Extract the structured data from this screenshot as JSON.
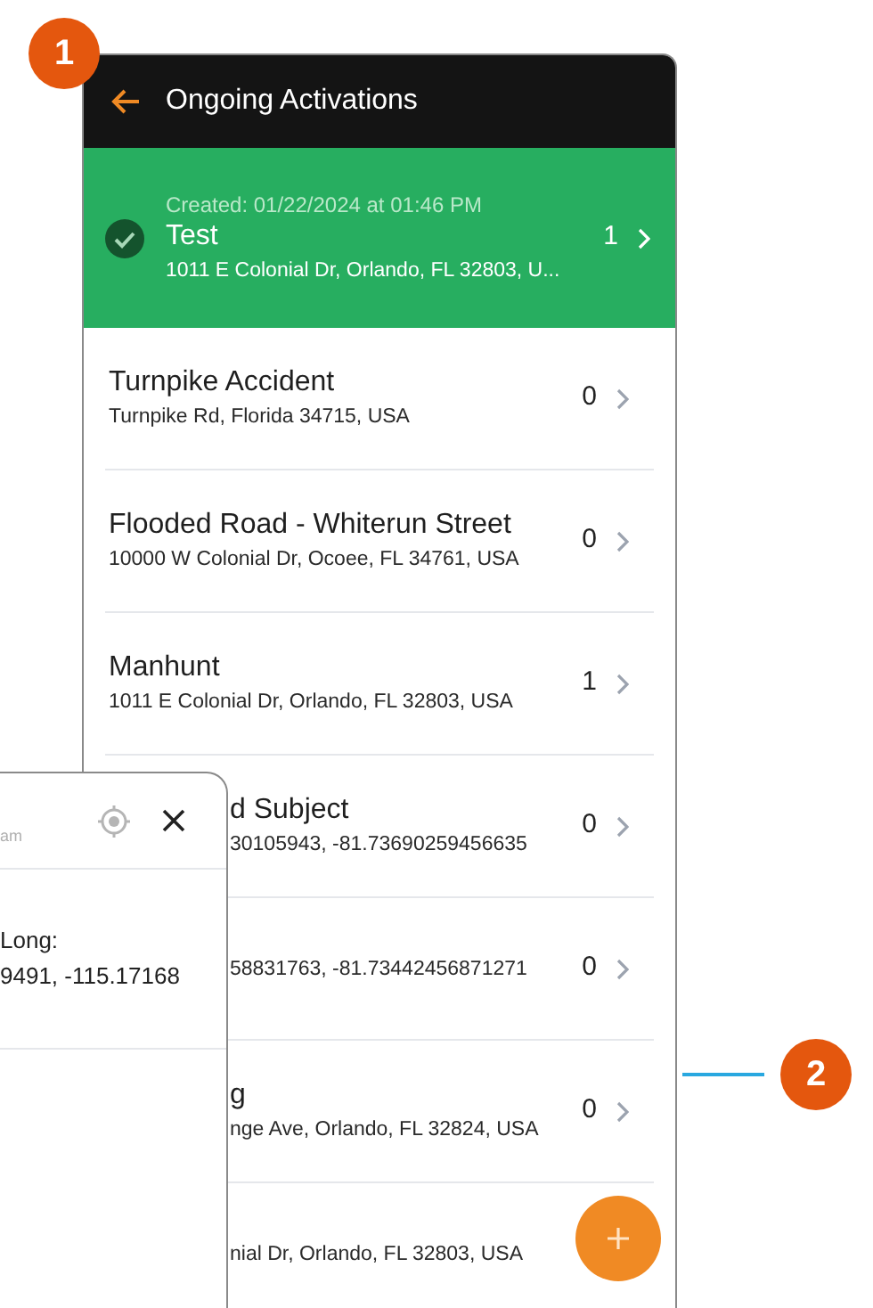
{
  "callouts": [
    {
      "label": "1"
    },
    {
      "label": "2"
    }
  ],
  "header": {
    "title": "Ongoing Activations"
  },
  "activations": [
    {
      "kind": "active",
      "created": "Created: 01/22/2024 at 01:46 PM",
      "title": "Test",
      "address": "1011 E Colonial Dr, Orlando, FL 32803, U...",
      "count": "1",
      "selected": true
    },
    {
      "kind": "full",
      "title": "Turnpike Accident",
      "address": "Turnpike Rd, Florida 34715, USA",
      "count": "0",
      "selected": false
    },
    {
      "kind": "full",
      "title": "Flooded Road - Whiterun Street",
      "address": "10000 W Colonial Dr, Ocoee, FL 34761, USA",
      "count": "0",
      "selected": false
    },
    {
      "kind": "full",
      "title": "Manhunt",
      "address": "1011 E Colonial Dr, Orlando, FL 32803, USA",
      "count": "1",
      "selected": false
    },
    {
      "kind": "covered",
      "title": "d Subject",
      "address": "30105943, -81.73690259456635",
      "count": "0",
      "selected": false
    },
    {
      "kind": "covered",
      "address": "58831763, -81.73442456871271",
      "count": "0",
      "selected": false
    },
    {
      "kind": "covered",
      "title": "g",
      "address": "nge Ave, Orlando, FL 32824, USA",
      "count": "0",
      "selected": false
    },
    {
      "kind": "covered",
      "address": "nial Dr, Orlando, FL 32803, USA",
      "selected": false
    }
  ],
  "popup": {
    "hint": "am",
    "label": "Long:",
    "value": "9491, -115.17168"
  }
}
